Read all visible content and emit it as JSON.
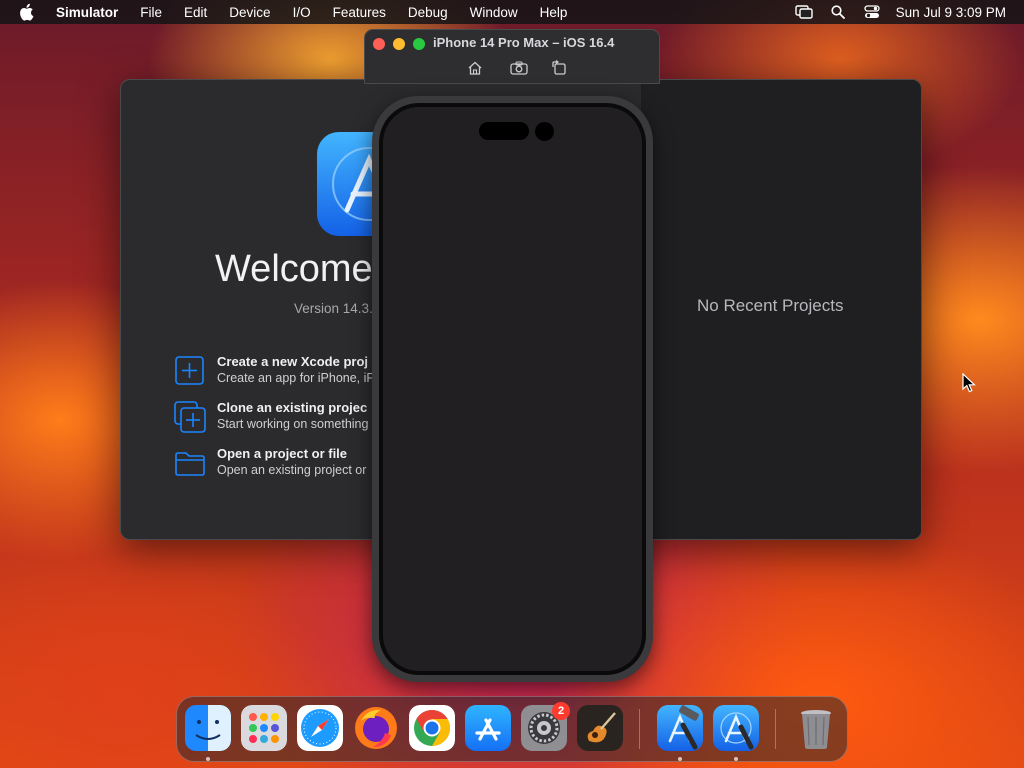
{
  "menubar": {
    "app_name": "Simulator",
    "items": [
      "File",
      "Edit",
      "Device",
      "I/O",
      "Features",
      "Debug",
      "Window",
      "Help"
    ],
    "clock": "Sun Jul 9  3:09 PM",
    "status_icons": [
      "screen-mirroring-icon",
      "spotlight-search-icon",
      "control-center-icon"
    ]
  },
  "xcode_welcome": {
    "title": "Welcome",
    "version": "Version 14.3.",
    "actions": [
      {
        "title": "Create a new Xcode proj",
        "subtitle": "Create an app for iPhone, iP",
        "icon": "plus-square-icon"
      },
      {
        "title": "Clone an existing projec",
        "subtitle": "Start working on something",
        "icon": "clone-plus-icon"
      },
      {
        "title": "Open a project or file",
        "subtitle": "Open an existing project or",
        "icon": "folder-icon"
      }
    ],
    "recent_placeholder": "No Recent Projects"
  },
  "simulator": {
    "title": "iPhone 14 Pro Max – iOS 16.4",
    "toolbar_buttons": [
      "home-icon",
      "screenshot-icon",
      "rotate-icon"
    ]
  },
  "dock": {
    "apps": [
      "finder-icon",
      "launchpad-icon",
      "safari-icon",
      "firefox-icon",
      "chrome-icon",
      "app-store-icon",
      "system-settings-icon",
      "garageband-icon",
      "xcode-icon",
      "simulator-icon",
      "trash-icon"
    ],
    "settings_badge": "2"
  },
  "colors": {
    "accent_blue": "#1a84ff",
    "close": "#ff5f57",
    "minimize": "#febc2e",
    "zoom": "#28c840",
    "badge": "#ff3b30"
  }
}
